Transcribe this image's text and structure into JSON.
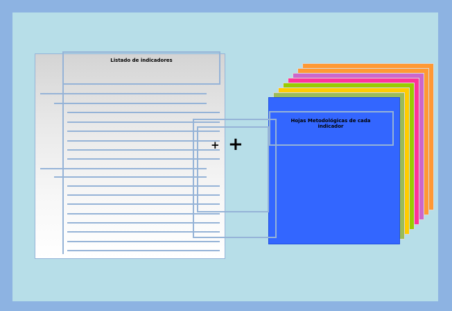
{
  "diagram": {
    "list_title": "Listado de indicadores",
    "sheets_title": "Hojas Metodológicas de cada indicador",
    "plus_small": "+",
    "plus_large": "+"
  },
  "colors": {
    "frame": "#8db3e2",
    "background": "#b7dee8",
    "outline": "#95b3d7",
    "front_sheet": "#3366ff",
    "sheet_stack": [
      "#9bbb59",
      "#ffcc00",
      "#99cc00",
      "#ff3399",
      "#cc66cc",
      "#ff9933",
      "#ff9933"
    ]
  }
}
